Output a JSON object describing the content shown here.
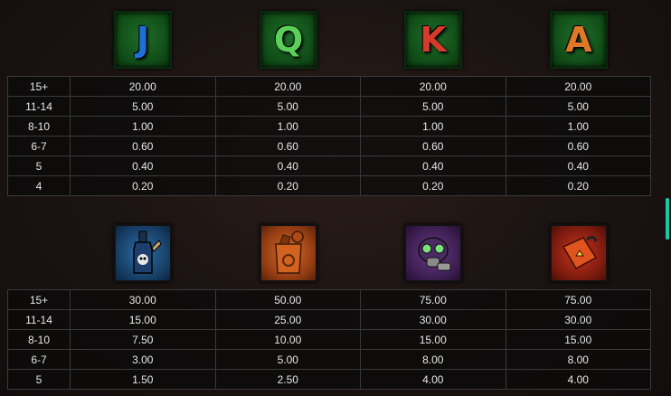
{
  "colors": {
    "j": "#1e6fd6",
    "q": "#5ad05a",
    "k": "#d63a2a",
    "a": "#e0782a",
    "scrollbar": "#16c9a6"
  },
  "top_symbols": [
    {
      "label": "J",
      "name": "letter-j"
    },
    {
      "label": "Q",
      "name": "letter-q"
    },
    {
      "label": "K",
      "name": "letter-k"
    },
    {
      "label": "A",
      "name": "letter-a"
    }
  ],
  "bottom_symbols": [
    {
      "icon": "bottle-icon",
      "color": "blue"
    },
    {
      "icon": "canister-icon",
      "color": "orange"
    },
    {
      "icon": "gas-mask-icon",
      "color": "purple"
    },
    {
      "icon": "fuel-can-icon",
      "color": "red"
    }
  ],
  "top_table": [
    [
      "15+",
      "20.00",
      "20.00",
      "20.00",
      "20.00"
    ],
    [
      "11-14",
      "5.00",
      "5.00",
      "5.00",
      "5.00"
    ],
    [
      "8-10",
      "1.00",
      "1.00",
      "1.00",
      "1.00"
    ],
    [
      "6-7",
      "0.60",
      "0.60",
      "0.60",
      "0.60"
    ],
    [
      "5",
      "0.40",
      "0.40",
      "0.40",
      "0.40"
    ],
    [
      "4",
      "0.20",
      "0.20",
      "0.20",
      "0.20"
    ]
  ],
  "bottom_table": [
    [
      "15+",
      "30.00",
      "50.00",
      "75.00",
      "75.00"
    ],
    [
      "11-14",
      "15.00",
      "25.00",
      "30.00",
      "30.00"
    ],
    [
      "8-10",
      "7.50",
      "10.00",
      "15.00",
      "15.00"
    ],
    [
      "6-7",
      "3.00",
      "5.00",
      "8.00",
      "8.00"
    ],
    [
      "5",
      "1.50",
      "2.50",
      "4.00",
      "4.00"
    ]
  ]
}
